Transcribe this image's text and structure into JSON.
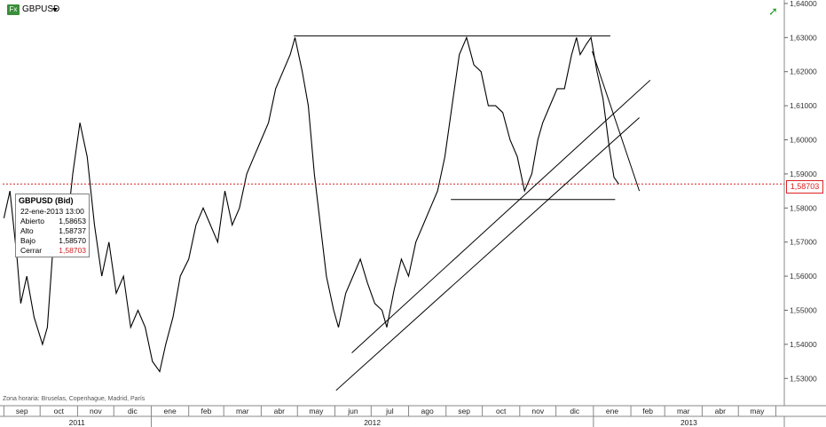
{
  "header": {
    "symbol": "GBPUSD",
    "fx_icon_text": "Fx",
    "symbol_menu_icon": "chevron-down-icon",
    "status_icon": "trend-up-icon"
  },
  "tooltip": {
    "title": "GBPUSD (Bid)",
    "date": "22-ene-2013 13:00",
    "rows": [
      {
        "label": "Abierto",
        "value": "1,58653"
      },
      {
        "label": "Alto",
        "value": "1,58737"
      },
      {
        "label": "Bajo",
        "value": "1,58570"
      },
      {
        "label": "Cerrar",
        "value": "1,58703",
        "color": "#d22222"
      }
    ]
  },
  "timezone_note": "Zona horaria: Bruselas, Copenhague, Madrid, París",
  "chart_data": {
    "type": "line",
    "title": "",
    "xlabel": "",
    "ylabel": "",
    "x_month_labels": [
      "sep",
      "oct",
      "nov",
      "dic",
      "ene",
      "feb",
      "mar",
      "abr",
      "may",
      "jun",
      "jul",
      "ago",
      "sep",
      "oct",
      "nov",
      "dic",
      "ene",
      "feb",
      "mar",
      "abr",
      "may"
    ],
    "x_year_labels": [
      "2011",
      "2012",
      "2013"
    ],
    "y_tick_labels": [
      "1,64000",
      "1,63000",
      "1,62000",
      "1,61000",
      "1,60000",
      "1,59000",
      "1,58000",
      "1,57000",
      "1,56000",
      "1,55000",
      "1,54000",
      "1,53000"
    ],
    "ylim": [
      1.522,
      1.6405
    ],
    "current_price": 1.58703,
    "current_price_label": "1,58703",
    "colors": {
      "price_line": "#000000",
      "current_price_line": "#d22222",
      "trendlines": "#000000"
    },
    "series": [
      {
        "x": [
          "2011-09-01",
          "2011-09-06",
          "2011-09-12",
          "2011-09-15",
          "2011-09-20",
          "2011-09-26",
          "2011-10-03",
          "2011-10-07",
          "2011-10-11",
          "2011-10-16",
          "2011-10-22",
          "2011-10-28",
          "2011-11-03",
          "2011-11-09",
          "2011-11-15",
          "2011-11-21",
          "2011-11-27",
          "2011-12-03",
          "2011-12-09",
          "2011-12-15",
          "2011-12-21",
          "2011-12-27",
          "2012-01-02",
          "2012-01-08",
          "2012-01-13",
          "2012-01-19",
          "2012-01-25",
          "2012-02-01",
          "2012-02-07",
          "2012-02-13",
          "2012-02-19",
          "2012-02-25",
          "2012-03-02",
          "2012-03-08",
          "2012-03-14",
          "2012-03-20",
          "2012-03-26",
          "2012-04-01",
          "2012-04-07",
          "2012-04-13",
          "2012-04-19",
          "2012-04-25",
          "2012-04-29",
          "2012-05-05",
          "2012-05-10",
          "2012-05-15",
          "2012-05-20",
          "2012-05-25",
          "2012-05-31",
          "2012-06-04",
          "2012-06-10",
          "2012-06-16",
          "2012-06-22",
          "2012-06-28",
          "2012-07-04",
          "2012-07-10",
          "2012-07-14",
          "2012-07-20",
          "2012-07-26",
          "2012-08-01",
          "2012-08-07",
          "2012-08-13",
          "2012-08-19",
          "2012-08-25",
          "2012-08-31",
          "2012-09-06",
          "2012-09-12",
          "2012-09-18",
          "2012-09-24",
          "2012-09-30",
          "2012-10-06",
          "2012-10-12",
          "2012-10-18",
          "2012-10-24",
          "2012-10-30",
          "2012-11-05",
          "2012-11-11",
          "2012-11-16",
          "2012-11-20",
          "2012-11-26",
          "2012-12-02",
          "2012-12-08",
          "2012-12-14",
          "2012-12-18",
          "2012-12-21",
          "2012-12-26",
          "2012-12-30",
          "2013-01-04",
          "2013-01-09",
          "2013-01-14",
          "2013-01-18",
          "2013-01-22"
        ],
        "y": [
          1.577,
          1.585,
          1.565,
          1.552,
          1.56,
          1.548,
          1.54,
          1.545,
          1.565,
          1.58,
          1.57,
          1.59,
          1.605,
          1.595,
          1.575,
          1.56,
          1.57,
          1.555,
          1.56,
          1.545,
          1.55,
          1.545,
          1.535,
          1.532,
          1.54,
          1.548,
          1.56,
          1.565,
          1.575,
          1.58,
          1.575,
          1.57,
          1.585,
          1.575,
          1.58,
          1.59,
          1.595,
          1.6,
          1.605,
          1.615,
          1.62,
          1.625,
          1.63,
          1.62,
          1.61,
          1.59,
          1.575,
          1.56,
          1.55,
          1.545,
          1.555,
          1.56,
          1.565,
          1.558,
          1.552,
          1.55,
          1.545,
          1.556,
          1.565,
          1.56,
          1.57,
          1.575,
          1.58,
          1.585,
          1.595,
          1.61,
          1.625,
          1.63,
          1.622,
          1.62,
          1.61,
          1.61,
          1.608,
          1.6,
          1.595,
          1.585,
          1.59,
          1.6,
          1.605,
          1.61,
          1.615,
          1.615,
          1.625,
          1.63,
          1.625,
          1.628,
          1.63,
          1.62,
          1.612,
          1.598,
          1.589,
          1.587
        ]
      }
    ],
    "trendlines": [
      {
        "from": {
          "x": "2012-04-28",
          "y": 1.6305
        },
        "to": {
          "x": "2013-01-15",
          "y": 1.6305
        }
      },
      {
        "from": {
          "x": "2012-09-05",
          "y": 1.5825
        },
        "to": {
          "x": "2013-01-19",
          "y": 1.5825
        }
      },
      {
        "from": {
          "x": "2012-06-02",
          "y": 1.5265
        },
        "to": {
          "x": "2013-02-08",
          "y": 1.6065
        }
      },
      {
        "from": {
          "x": "2012-06-15",
          "y": 1.5375
        },
        "to": {
          "x": "2013-02-17",
          "y": 1.6175
        }
      },
      {
        "from": {
          "x": "2012-12-31",
          "y": 1.626
        },
        "to": {
          "x": "2013-02-08",
          "y": 1.585
        }
      }
    ]
  }
}
